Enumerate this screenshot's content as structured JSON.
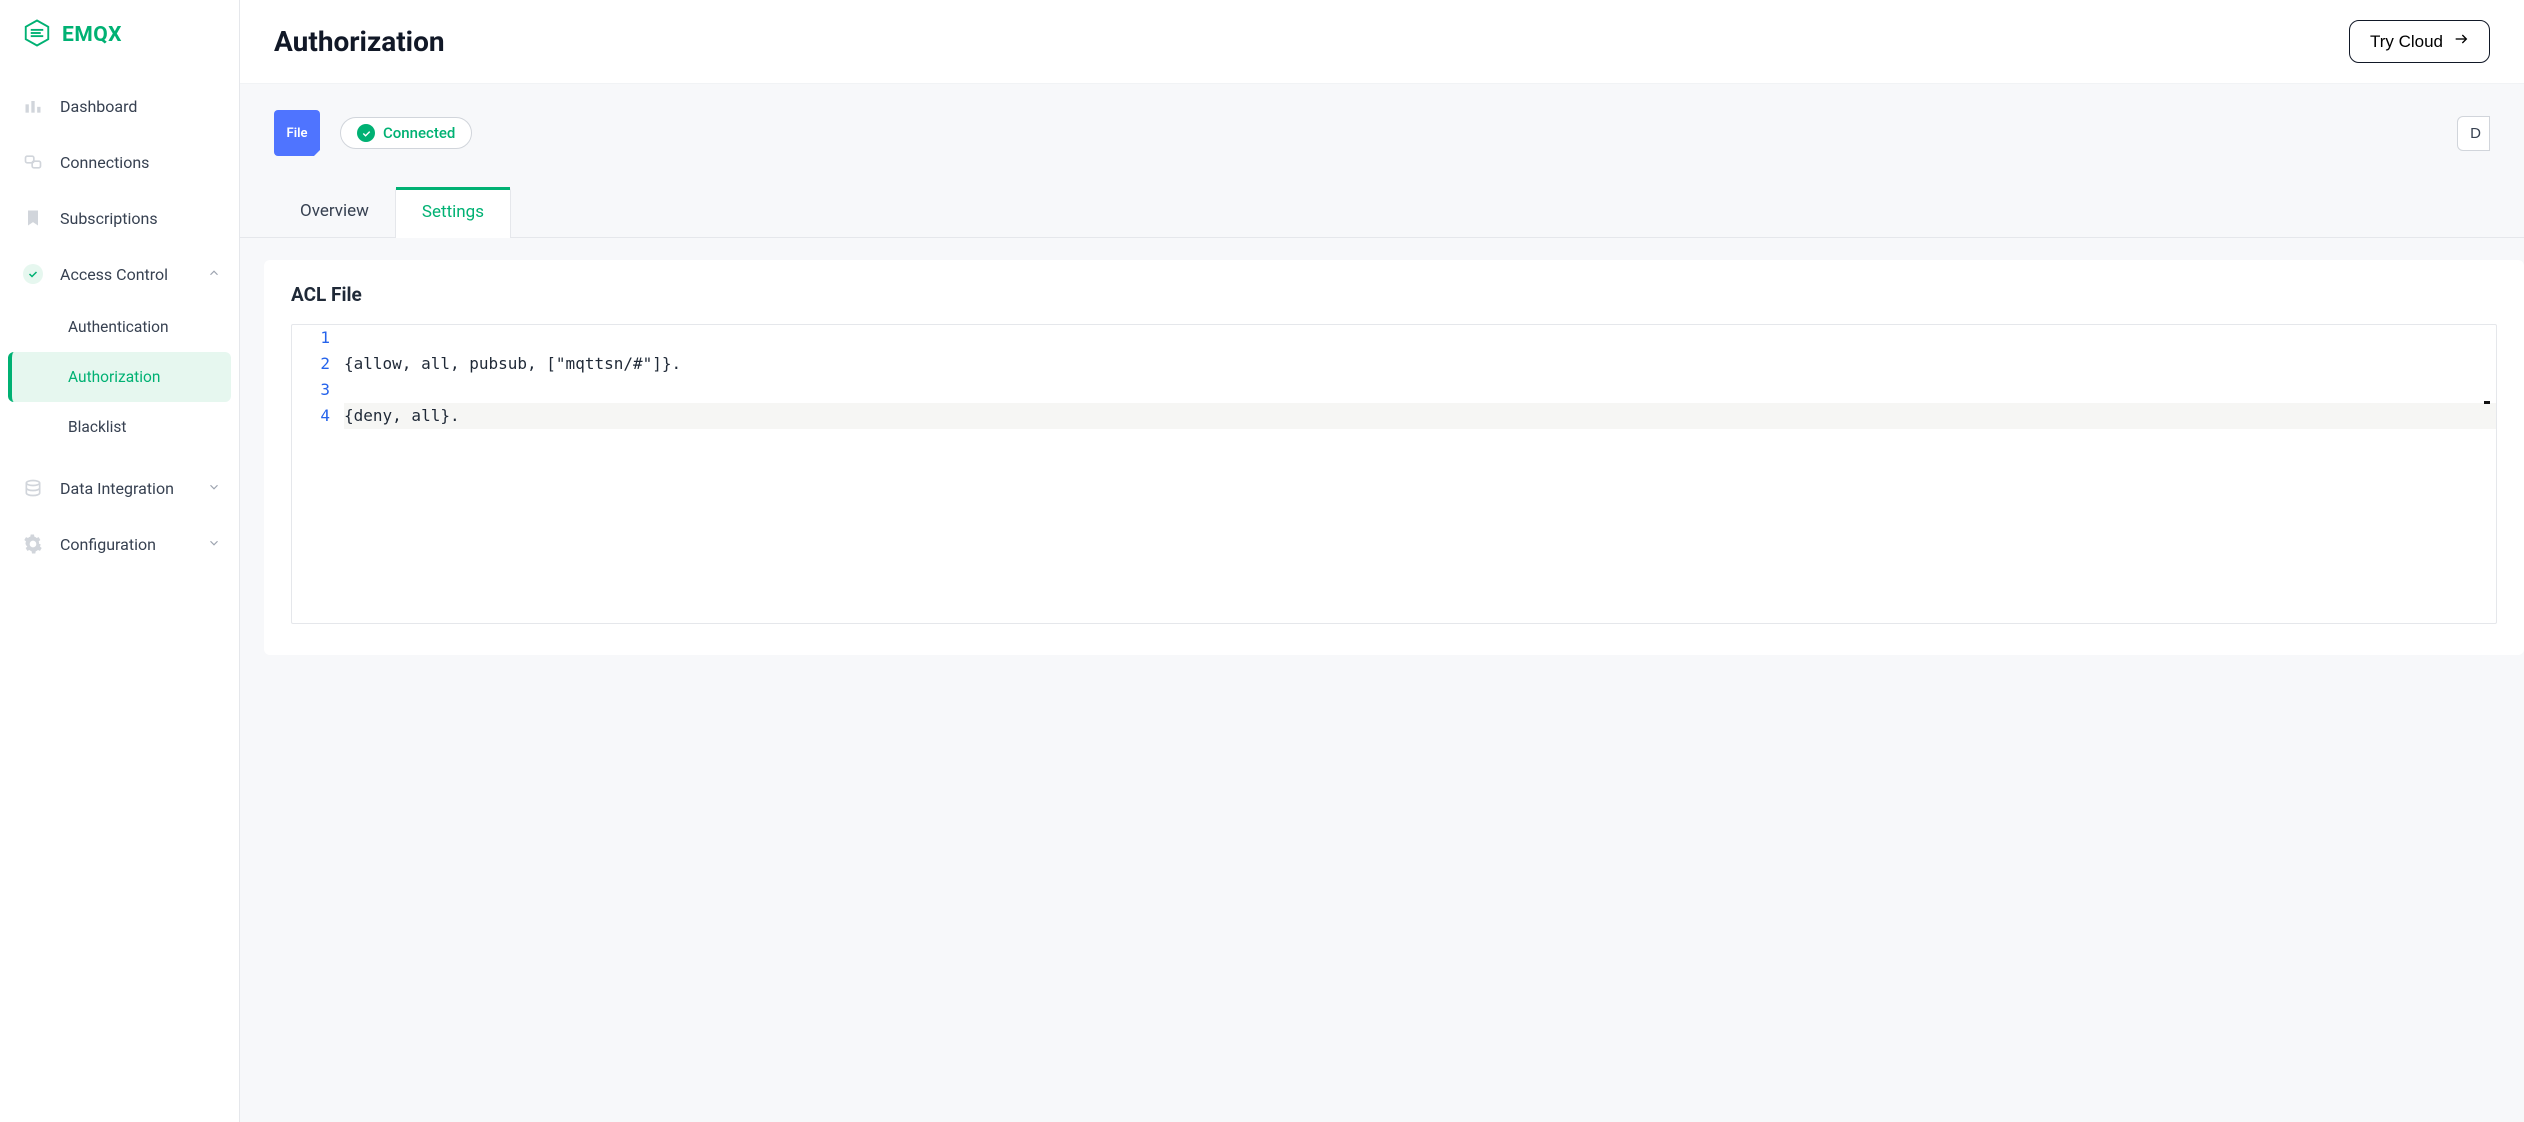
{
  "brand": {
    "name": "EMQX"
  },
  "sidebar": {
    "items": [
      {
        "label": "Dashboard"
      },
      {
        "label": "Connections"
      },
      {
        "label": "Subscriptions"
      },
      {
        "label": "Access Control",
        "expanded": true,
        "children": [
          {
            "label": "Authentication"
          },
          {
            "label": "Authorization",
            "active": true
          },
          {
            "label": "Blacklist"
          }
        ]
      },
      {
        "label": "Data Integration"
      },
      {
        "label": "Configuration"
      }
    ]
  },
  "header": {
    "title": "Authorization",
    "try_cloud": "Try Cloud"
  },
  "source": {
    "chip_label": "File",
    "status": "Connected"
  },
  "tabs": [
    {
      "label": "Overview"
    },
    {
      "label": "Settings",
      "active": true
    }
  ],
  "panel": {
    "title": "ACL File",
    "code_lines": [
      "",
      "{allow, all, pubsub, [\"mqttsn/#\"]}.",
      "",
      "{deny, all}."
    ]
  }
}
